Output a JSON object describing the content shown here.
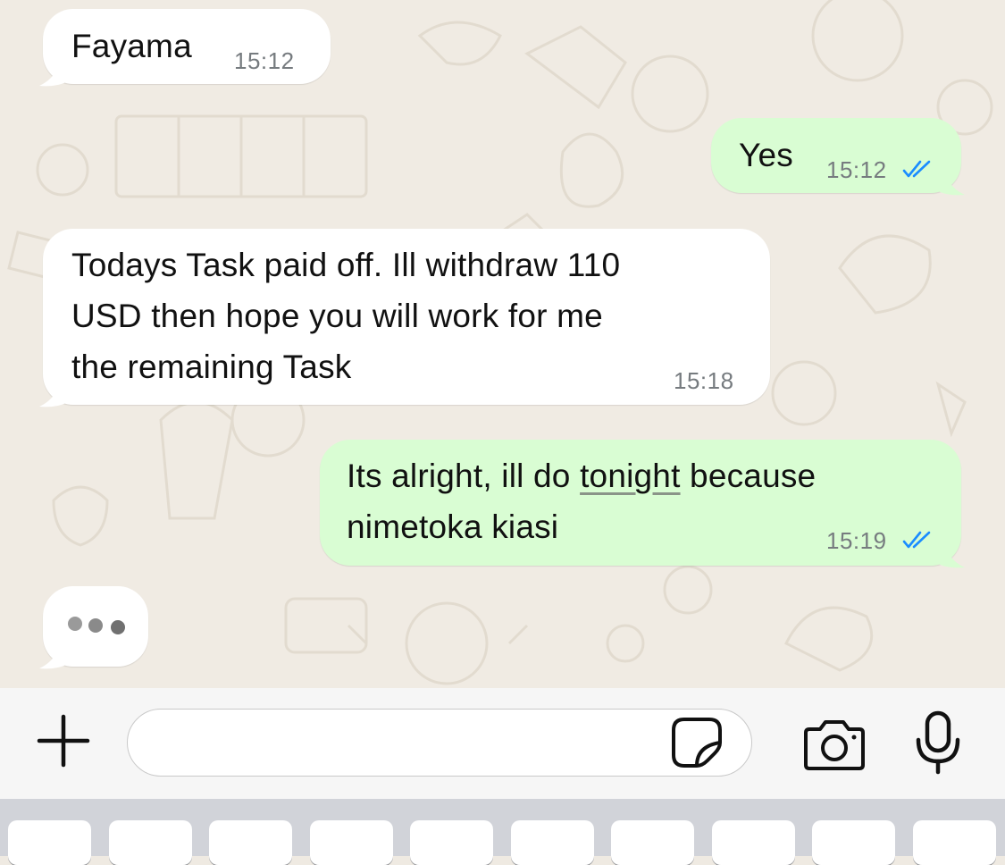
{
  "messages": [
    {
      "direction": "incoming",
      "text": "Fayama",
      "time": "15:12"
    },
    {
      "direction": "outgoing",
      "text": "Yes",
      "time": "15:12",
      "status": "read"
    },
    {
      "direction": "incoming",
      "text": "Todays Task paid off. Ill withdraw 110\nUSD then hope you will work for me\nthe remaining Task",
      "time": "15:18"
    },
    {
      "direction": "outgoing",
      "text_before": "Its alright, ill do ",
      "text_underlined": "tonight",
      "text_after": " because\nnimetoka kiasi",
      "time": "15:19",
      "status": "read"
    }
  ],
  "typing_indicator": {
    "visible": true
  },
  "composer": {
    "input_value": "",
    "icons": [
      "plus-icon",
      "sticker-icon",
      "camera-icon",
      "microphone-icon"
    ]
  },
  "colors": {
    "wallpaper": "#f0ebe3",
    "incoming_bubble": "#ffffff",
    "outgoing_bubble": "#d9fdd3",
    "read_ticks": "#1a8cff",
    "timestamp": "#767b7f"
  }
}
